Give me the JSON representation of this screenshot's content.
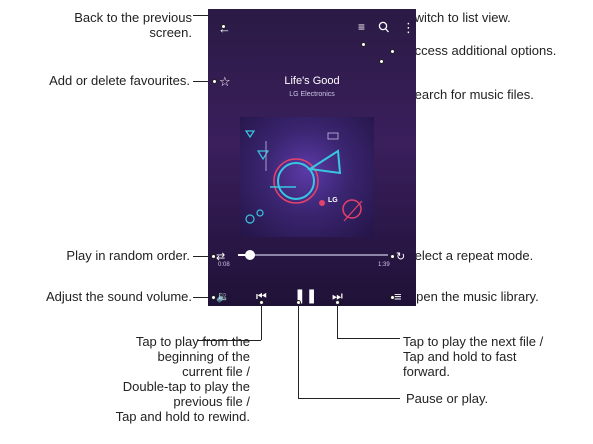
{
  "callouts": {
    "back": "Back to the previous\nscreen.",
    "favourites": "Add or delete favourites.",
    "random": "Play in random order.",
    "volume": "Adjust the sound volume.",
    "play_prev": "Tap to play from the\nbeginning of the\ncurrent file /\nDouble-tap to play the\nprevious file /\nTap and hold to rewind.",
    "list_view": "Switch to list view.",
    "options": "Access additional options.",
    "search": "Search for music files.",
    "repeat": "Select a repeat mode.",
    "library": "Open the music library.",
    "play_next": "Tap to play the next file /\nTap and hold to fast\nforward.",
    "pause": "Pause or play."
  },
  "player": {
    "song_title": "Life's Good",
    "artist": "LG Electronics",
    "elapsed": "0:08",
    "total": "1:39",
    "progress": 0.08,
    "album_logo": "LG"
  },
  "icons": {
    "back": "back-arrow-icon",
    "list_view": "list-view-icon",
    "search": "search-icon",
    "more": "more-options-icon",
    "favourite": "star-icon",
    "shuffle": "shuffle-icon",
    "repeat": "repeat-icon",
    "volume": "volume-icon",
    "previous": "previous-track-icon",
    "pause": "pause-icon",
    "next": "next-track-icon",
    "library": "library-icon"
  },
  "colors": {
    "background": "#ffffff",
    "text": "#222222",
    "player_bg": "#2e1b4d",
    "album_accent_cyan": "#39c6e0",
    "album_accent_pink": "#e4416b"
  }
}
